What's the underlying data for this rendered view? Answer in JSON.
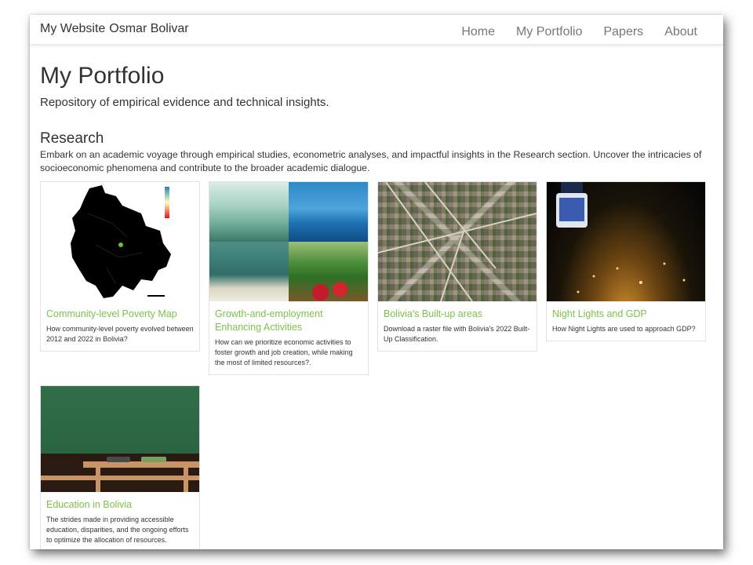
{
  "navbar": {
    "brand": "My Website",
    "author": "Osmar Bolivar",
    "links": [
      "Home",
      "My Portfolio",
      "Papers",
      "About"
    ]
  },
  "page": {
    "title": "My Portfolio",
    "subtitle": "Repository of empirical evidence and technical insights."
  },
  "section": {
    "title": "Research",
    "description": "Embark on an academic voyage through empirical studies, econometric analyses, and impactful insights in the Research section. Uncover the intricacies of socioeconomic phenomena and contribute to the broader academic dialogue."
  },
  "cards": [
    {
      "title": "Community-level Poverty Map",
      "description": "How community-level poverty evolved between 2012 and 2022 in Bolivia?",
      "image": "bolivia-poverty-map"
    },
    {
      "title": "Growth-and-employment Enhancing Activities",
      "description": "How can we prioritize economic activities to foster growth and job creation, while making the most of limited resources?.",
      "image": "sectors-collage"
    },
    {
      "title": "Bolivia's Built-up areas",
      "description": "Download a raster file with Bolivia's 2022 Built-Up Classification.",
      "image": "satellite-urban-view"
    },
    {
      "title": "Night Lights and GDP",
      "description": "How Night Lights are used to approach GDP?",
      "image": "earth-night-lights"
    },
    {
      "title": "Education in Bolivia",
      "description": "The strides made in providing accessible education, disparities, and the ongoing efforts to optimize the allocation of resources.",
      "image": "classroom-chalkboard"
    }
  ],
  "colors": {
    "card_title": "#7cc24a",
    "nav_link": "#777777",
    "text": "#333333"
  }
}
